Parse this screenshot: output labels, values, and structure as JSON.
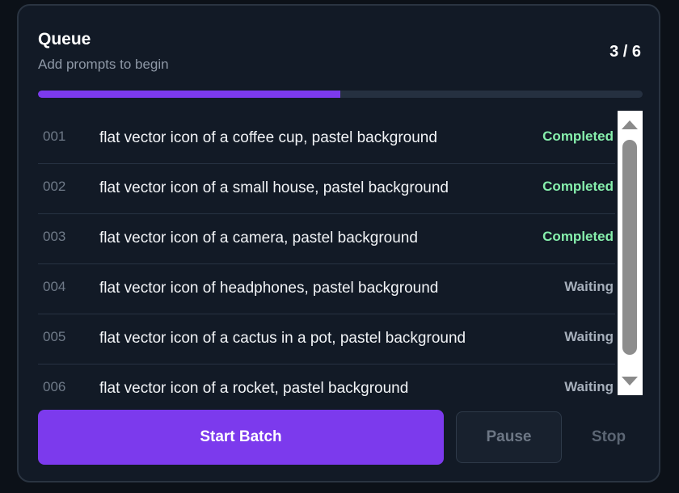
{
  "queue": {
    "title": "Queue",
    "subtitle": "Add prompts to begin",
    "counter": "3 / 6",
    "progress": 0.5,
    "colors": {
      "accent": "#7c3aed",
      "completed": "#86efac",
      "waiting": "#a7b0bc"
    },
    "items": [
      {
        "num": "001",
        "text": "flat vector icon of a coffee cup, pastel background",
        "status": "Completed",
        "state": "completed"
      },
      {
        "num": "002",
        "text": "flat vector icon of a small house, pastel background",
        "status": "Completed",
        "state": "completed"
      },
      {
        "num": "003",
        "text": "flat vector icon of a camera, pastel background",
        "status": "Completed",
        "state": "completed"
      },
      {
        "num": "004",
        "text": "flat vector icon of headphones, pastel background",
        "status": "Waiting",
        "state": "waiting"
      },
      {
        "num": "005",
        "text": "flat vector icon of a cactus in a pot, pastel background",
        "status": "Waiting",
        "state": "waiting"
      },
      {
        "num": "006",
        "text": "flat vector icon of a rocket, pastel background",
        "status": "Waiting",
        "state": "waiting"
      }
    ]
  },
  "controls": {
    "start_label": "Start Batch",
    "pause_label": "Pause",
    "stop_label": "Stop"
  },
  "icons": {
    "scroll_up": "scroll-up-arrow-icon",
    "scroll_down": "scroll-down-arrow-icon"
  }
}
